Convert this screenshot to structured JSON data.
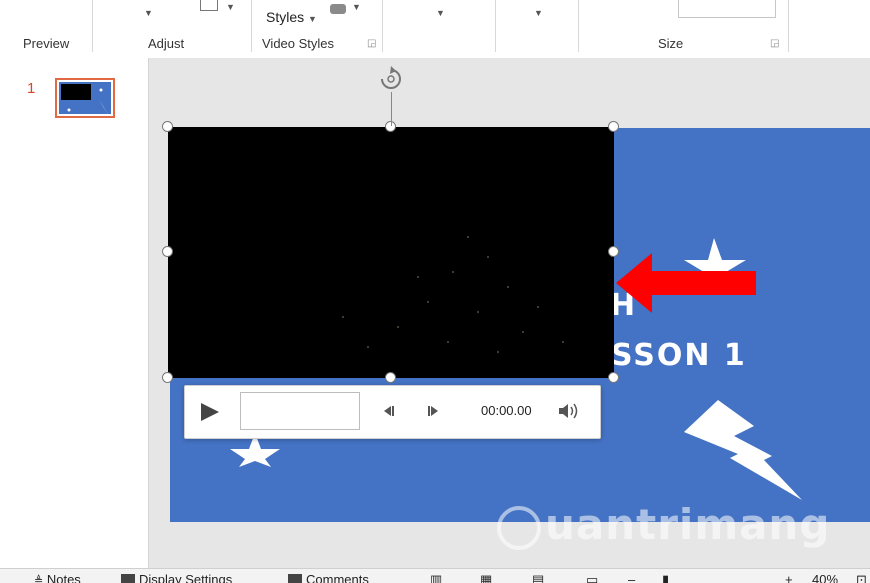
{
  "ribbon": {
    "groups": {
      "preview": "Preview",
      "adjust": "Adjust",
      "video_styles": "Video Styles",
      "size": "Size"
    },
    "styles_button": "Styles"
  },
  "slides_pane": {
    "slide_number": "1"
  },
  "slide": {
    "text_line1": "H",
    "text_line2": "SSON 1"
  },
  "video_controls": {
    "time": "00:00.00"
  },
  "status_bar": {
    "notes": "Notes",
    "display_settings": "Display Settings",
    "comments": "Comments",
    "zoom": "40%"
  },
  "watermark": {
    "text": "uantrimang"
  },
  "colors": {
    "slide_bg": "#4472c4",
    "accent": "#d24726",
    "arrow": "#ff0000"
  }
}
